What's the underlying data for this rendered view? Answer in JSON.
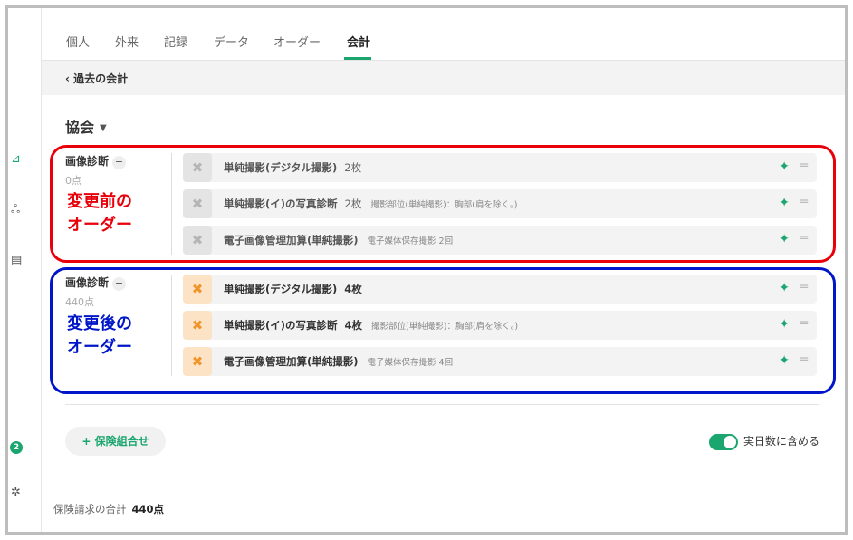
{
  "tabs": [
    {
      "label": "個人"
    },
    {
      "label": "外来"
    },
    {
      "label": "記録"
    },
    {
      "label": "データ"
    },
    {
      "label": "オーダー"
    },
    {
      "label": "会計"
    }
  ],
  "active_tab": "会計",
  "back_link": "過去の会計",
  "society": {
    "label": "協会"
  },
  "groups": [
    {
      "label": "画像診断",
      "points": "0点",
      "state": "before",
      "rows": [
        {
          "name": "単純撮影(デジタル撮影)",
          "qty": "2枚",
          "note": ""
        },
        {
          "name": "単純撮影(イ)の写真診断",
          "qty": "2枚",
          "note": "撮影部位(単純撮影)：胸部(肩を除く。)"
        },
        {
          "name": "電子画像管理加算(単純撮影)",
          "qty": "",
          "note": "電子媒体保存撮影 2回"
        }
      ]
    },
    {
      "label": "画像診断",
      "points": "440点",
      "state": "after",
      "rows": [
        {
          "name": "単純撮影(デジタル撮影)",
          "qty": "4枚",
          "note": ""
        },
        {
          "name": "単純撮影(イ)の写真診断",
          "qty": "4枚",
          "note": "撮影部位(単純撮影)：胸部(肩を除く。)"
        },
        {
          "name": "電子画像管理加算(単純撮影)",
          "qty": "",
          "note": "電子媒体保存撮影 4回"
        }
      ]
    }
  ],
  "annotations": {
    "before": {
      "line1": "変更前の",
      "line2": "オーダー",
      "color": "#e8000a"
    },
    "after": {
      "line1": "変更後の",
      "line2": "オーダー",
      "color": "#0016c8"
    }
  },
  "add_insurance_button": "+ 保険組合せ",
  "toggle": {
    "label": "実日数に含める",
    "on": true
  },
  "footer": {
    "total_label": "保険請求の合計",
    "total_value": "440点"
  },
  "left_rail": {
    "badge": "2"
  },
  "colors": {
    "accent": "#1aa66e",
    "orange_icon": "#f0952c"
  }
}
